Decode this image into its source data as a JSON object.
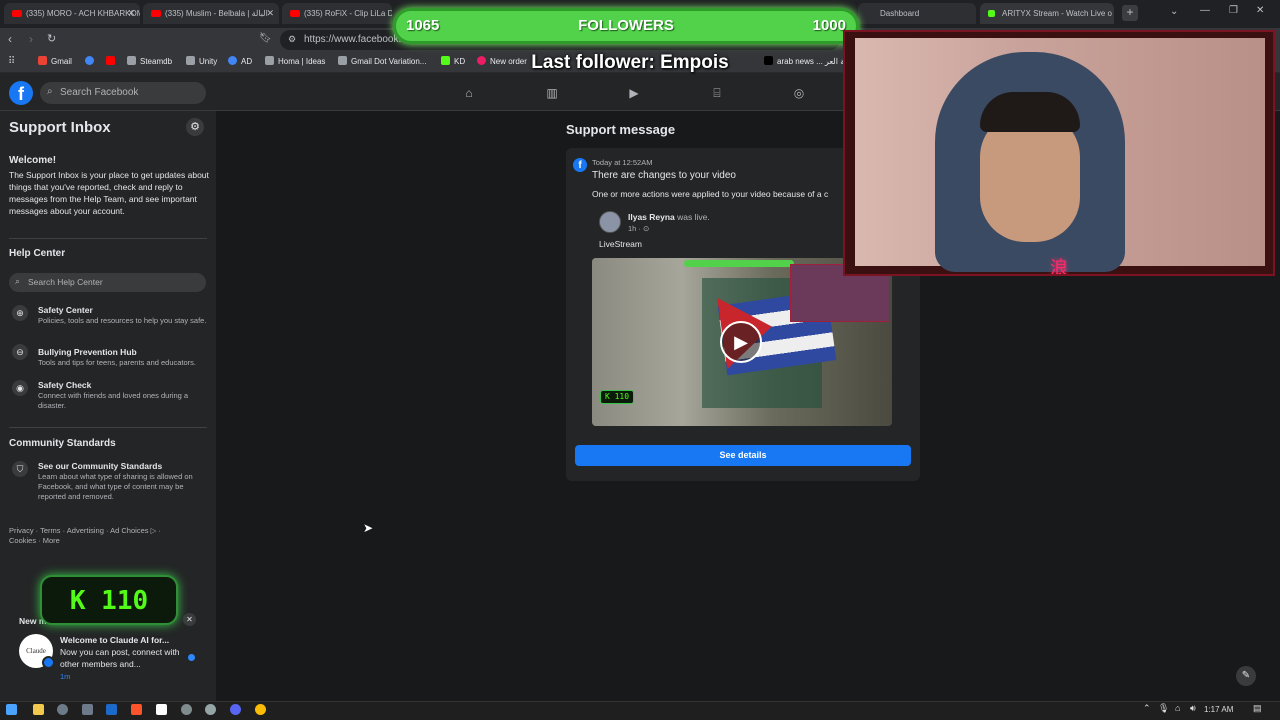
{
  "browser": {
    "tabs": [
      {
        "label": "(335) MORO - ACH KHBARKOM",
        "color": "#ff0000"
      },
      {
        "label": "(335) Muslim - Belbala | البالة",
        "color": "#ff0000"
      },
      {
        "label": "(335) RoFiX - Clip LiLa Do",
        "color": "#ff0000"
      },
      {
        "label": "Dashboard",
        "color": "#1877f2"
      },
      {
        "label": "ARITYX Stream - Watch Live o",
        "color": "#53fc18"
      }
    ],
    "url": "https://www.facebook.c",
    "bookmarks": [
      {
        "label": "Gmail",
        "color": "#ea4335"
      },
      {
        "label": "",
        "color": "#4285f4"
      },
      {
        "label": "",
        "color": "#ff0000"
      },
      {
        "label": "Steamdb",
        "color": "#9aa0a6"
      },
      {
        "label": "Unity",
        "color": "#9aa0a6"
      },
      {
        "label": "AD",
        "color": "#4285f4"
      },
      {
        "label": "Homa | Ideas",
        "color": "#9aa0a6"
      },
      {
        "label": "Gmail Dot Variation...",
        "color": "#9aa0a6"
      },
      {
        "label": "KD",
        "color": "#53fc18"
      },
      {
        "label": "New order",
        "color": "#e91e63"
      },
      {
        "label": "arab news ... باللغة العر",
        "color": "#000000"
      }
    ]
  },
  "facebook": {
    "logo": "f",
    "search_placeholder": "Search Facebook",
    "nav_icons": [
      "home-icon",
      "stats-icon",
      "video-icon",
      "marketplace-icon",
      "groups-icon"
    ]
  },
  "sidebar": {
    "title": "Support Inbox",
    "welcome_title": "Welcome!",
    "welcome_text": "The Support Inbox is your place to get updates about things that you've reported, check and reply to messages from the Help Team, and see important messages about your account.",
    "help_center_title": "Help Center",
    "help_search_placeholder": "Search Help Center",
    "help_items": [
      {
        "title": "Safety Center",
        "desc": "Policies, tools and resources to help you stay safe.",
        "icon": "lifebuoy-icon"
      },
      {
        "title": "Bullying Prevention Hub",
        "desc": "Tools and tips for teens, parents and educators.",
        "icon": "minus-circle-icon"
      },
      {
        "title": "Safety Check",
        "desc": "Connect with friends and loved ones during a disaster.",
        "icon": "target-icon"
      }
    ],
    "community_title": "Community Standards",
    "community_item": {
      "title": "See our Community Standards",
      "desc": "Learn about what type of sharing is allowed on Facebook, and what type of content may be reported and removed."
    },
    "footer_links": "Privacy · Terms · Advertising · Ad Choices ▷ · Cookies · More"
  },
  "support_message": {
    "heading": "Support message",
    "time": "Today at 12:52AM",
    "title": "There are changes to your video",
    "body": "One or more actions were applied to your video because of a c",
    "post_author": "Ilyas Reyna",
    "post_action": "was live.",
    "post_time": "1h · ⊙",
    "post_caption": "LiveStream",
    "video_kick_count": "110",
    "see_details": "See details"
  },
  "notification": {
    "header": "New m",
    "text_bold": "Welcome to Claude AI for...",
    "text_rest": "Now you can post, connect with other members and...",
    "time": "1m",
    "avatar_text": "Claude"
  },
  "overlays": {
    "followers_left": "1065",
    "followers_label": "FOLLOWERS",
    "followers_right": "1000",
    "last_follower": "Last follower: Empois",
    "kick_count": "110",
    "kanji": "浪"
  },
  "taskbar": {
    "time": "1:17 AM"
  }
}
